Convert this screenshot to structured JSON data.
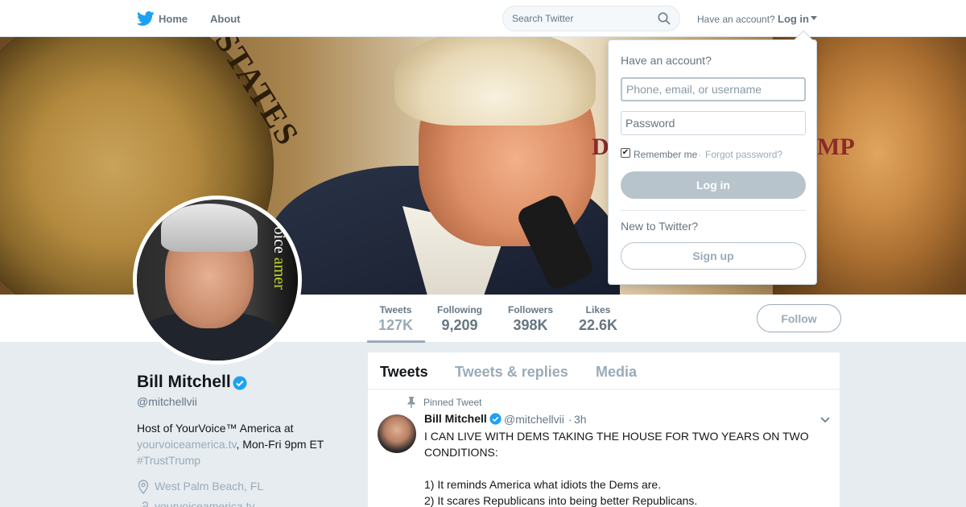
{
  "nav": {
    "home_label": "Home",
    "about_label": "About",
    "search_placeholder": "Search Twitter",
    "have_account_label": "Have an account?",
    "login_label": "Log in"
  },
  "banner": {
    "seal_text": "STATES",
    "letters_left": "D",
    "letters_right": "MP"
  },
  "avatar": {
    "text_white": "rVoice",
    "text_green": "amer"
  },
  "profile": {
    "name": "Bill Mitchell",
    "handle": "@mitchellvii",
    "bio_prefix": "Host of YourVoice™ America at",
    "bio_link": "yourvoiceamerica.tv",
    "bio_suffix": ", Mon-Fri 9pm ET",
    "bio_hashtag": "#TrustTrump",
    "location": "West Palm Beach, FL",
    "website": "yourvoiceamerica.tv"
  },
  "stats": [
    {
      "label": "Tweets",
      "value": "127K"
    },
    {
      "label": "Following",
      "value": "9,209"
    },
    {
      "label": "Followers",
      "value": "398K"
    },
    {
      "label": "Likes",
      "value": "22.6K"
    }
  ],
  "follow_label": "Follow",
  "timeline": {
    "tabs": [
      "Tweets",
      "Tweets & replies",
      "Media"
    ],
    "active_tab": "Tweets",
    "pinned_label": "Pinned Tweet",
    "tweet": {
      "name": "Bill Mitchell",
      "handle": "@mitchellvii",
      "separator": "·",
      "time": "3h",
      "text": "I CAN LIVE WITH DEMS TAKING THE HOUSE FOR TWO YEARS ON TWO CONDITIONS:\n\n1) It reminds America what idiots the Dems are.\n2) It scares Republicans into being better Republicans."
    }
  },
  "login_dropdown": {
    "title": "Have an account?",
    "username_placeholder": "Phone, email, or username",
    "password_placeholder": "Password",
    "remember_label": "Remember me",
    "remember_checked": true,
    "separator": "·",
    "forgot_label": "Forgot password?",
    "login_button": "Log in",
    "new_label": "New to Twitter?",
    "signup_button": "Sign up"
  },
  "colors": {
    "twitter_blue": "#1da1f2",
    "muted_text": "#657786",
    "disabled_button": "#b8c4cc"
  }
}
